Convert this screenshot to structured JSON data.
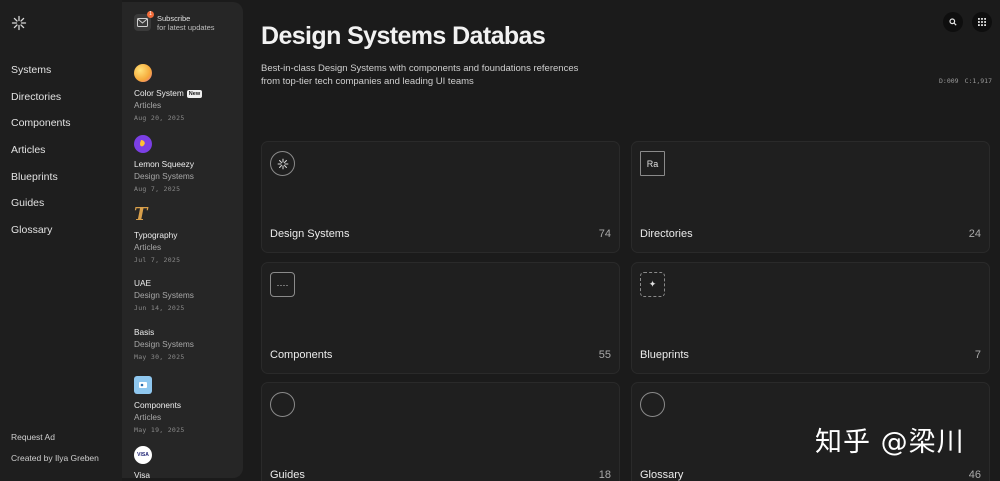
{
  "nav": {
    "items": [
      "Systems",
      "Directories",
      "Components",
      "Articles",
      "Blueprints",
      "Guides",
      "Glossary"
    ],
    "footer": {
      "request_ad": "Request Ad",
      "created_by": "Created by Ilya Greben"
    }
  },
  "subscribe": {
    "line1": "Subscribe",
    "line2": "for latest updates",
    "badge_count": "1"
  },
  "feed": [
    {
      "title": "Color System",
      "badge": "New",
      "category": "Articles",
      "date": "Aug 20, 2025",
      "icon": "color-blob-icon",
      "color": "#f6c44a"
    },
    {
      "title": "Lemon Squeezy",
      "category": "Design Systems",
      "date": "Aug 7, 2025",
      "icon": "lemon-squeezy-icon",
      "color": "#7b3fe4"
    },
    {
      "title": "Typography",
      "category": "Articles",
      "date": "Jul 7, 2025",
      "icon": "typography-t-icon",
      "color": "#c98a3b"
    },
    {
      "title": "UAE",
      "category": "Design Systems",
      "date": "Jun 14, 2025"
    },
    {
      "title": "Basis",
      "category": "Design Systems",
      "date": "May 30, 2025"
    },
    {
      "title": "Components",
      "category": "Articles",
      "date": "May 19, 2025",
      "icon": "components-card-icon",
      "color": "#8fc7ef"
    },
    {
      "title": "Visa",
      "icon": "visa-icon",
      "icon_text": "VISA",
      "color": "#ffffff"
    }
  ],
  "main": {
    "title": "Design Systems Databas",
    "description": "Best-in-class Design Systems with components and foundations references from top-tier tech companies and leading UI teams",
    "counts": {
      "d": "D:009",
      "c": "C:1,917"
    }
  },
  "cards": [
    {
      "label": "Design Systems",
      "count": "74",
      "icon": "asterisk-icon"
    },
    {
      "label": "Directories",
      "count": "24",
      "icon": "text-frame-icon",
      "icon_text": "Ra"
    },
    {
      "label": "Components",
      "count": "55",
      "icon": "dots-icon",
      "icon_text": "····"
    },
    {
      "label": "Blueprints",
      "count": "7",
      "icon": "sparkle-icon",
      "icon_text": "✦"
    },
    {
      "label": "Guides",
      "count": "18",
      "icon": "circle-icon"
    },
    {
      "label": "Glossary",
      "count": "46",
      "icon": "circle-icon"
    }
  ],
  "watermark": "知乎 @梁川",
  "colors": {
    "background": "#1b1b1b",
    "panel": "#262626",
    "card": "#1f1f1f",
    "accent": "#f26c3a"
  }
}
